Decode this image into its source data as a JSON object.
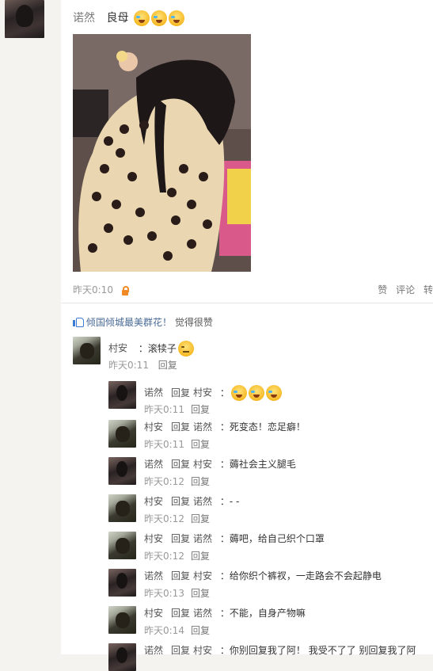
{
  "post": {
    "author": "诺然",
    "text": "良母",
    "emojis": [
      "laugh-cry",
      "laugh-cry",
      "laugh-cry"
    ],
    "time": "昨天0:10",
    "actions": [
      "赞",
      "评论",
      "转"
    ]
  },
  "likes": {
    "names": "倾国倾城最美群花！",
    "suffix": "觉得很赞"
  },
  "comment": {
    "author": "村安",
    "text": "：滚犊子",
    "emoji": "unamused",
    "time": "昨天0:11",
    "reply_label": "回复"
  },
  "replies": [
    {
      "from": "诺然",
      "reply_word": "回复",
      "to": "村安",
      "text": "：",
      "emojis": 3,
      "time": "昨天0:11",
      "reply_label": "回复"
    },
    {
      "from": "村安",
      "reply_word": "回复",
      "to": "诺然",
      "text": "：死变态！恋足癖！",
      "emojis": 0,
      "time": "昨天0:11",
      "reply_label": "回复"
    },
    {
      "from": "诺然",
      "reply_word": "回复",
      "to": "村安",
      "text": "：薅社会主义腿毛",
      "emojis": 0,
      "time": "昨天0:12",
      "reply_label": "回复"
    },
    {
      "from": "村安",
      "reply_word": "回复",
      "to": "诺然",
      "text": "：- -",
      "emojis": 0,
      "time": "昨天0:12",
      "reply_label": "回复"
    },
    {
      "from": "村安",
      "reply_word": "回复",
      "to": "诺然",
      "text": "：薅吧，给自己织个口罩",
      "emojis": 0,
      "time": "昨天0:12",
      "reply_label": "回复"
    },
    {
      "from": "诺然",
      "reply_word": "回复",
      "to": "村安",
      "text": "：给你织个裤衩，一走路会不会起静电",
      "emojis": 0,
      "time": "昨天0:13",
      "reply_label": "回复"
    },
    {
      "from": "村安",
      "reply_word": "回复",
      "to": "诺然",
      "text": "：不能，自身产物嘛",
      "emojis": 0,
      "time": "昨天0:14",
      "reply_label": "回复"
    },
    {
      "from": "诺然",
      "reply_word": "回复",
      "to": "村安",
      "text": "：你别回复我了阿！ 我受不了了 别回复我了阿",
      "emojis": 0,
      "time": "",
      "reply_label": ""
    }
  ]
}
